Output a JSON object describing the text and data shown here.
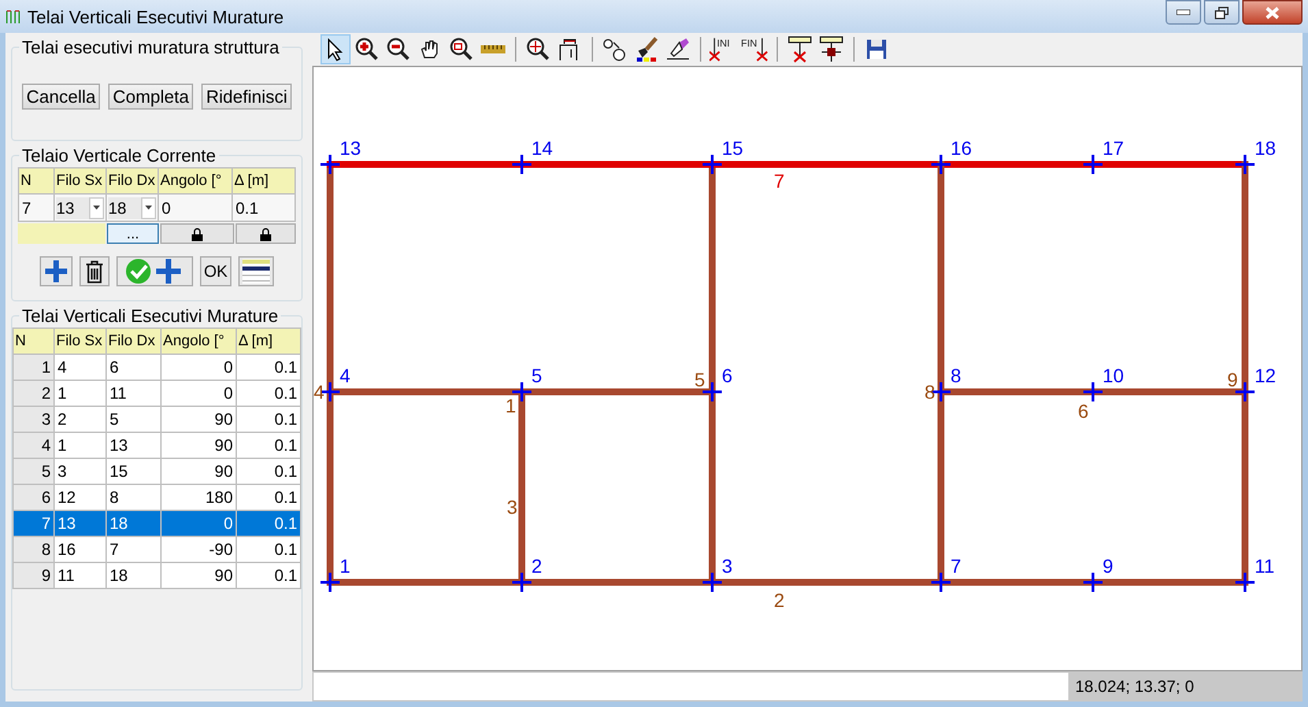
{
  "window": {
    "title": "Telai Verticali Esecutivi Murature"
  },
  "panel_actions": {
    "title": "Telai esecutivi muratura struttura",
    "buttons": [
      "Cancella",
      "Completa",
      "Ridefinisci"
    ]
  },
  "current_frame": {
    "title": "Telaio Verticale Corrente",
    "columns": [
      "N",
      "Filo Sx",
      "Filo Dx",
      "Angolo [°",
      "Δ [m]"
    ],
    "n": "7",
    "filo_sx": "13",
    "filo_dx": "18",
    "angolo": "0",
    "delta": "0.1",
    "browse_button": "...",
    "actions": [
      {
        "kind": "add"
      },
      {
        "kind": "delete"
      },
      {
        "kind": "confirm-add"
      },
      {
        "kind": "ok",
        "label": "OK"
      },
      {
        "kind": "list"
      }
    ]
  },
  "frames_table": {
    "title": "Telai Verticali Esecutivi Murature",
    "columns": [
      "N",
      "Filo Sx",
      "Filo Dx",
      "Angolo [°",
      "Δ [m]"
    ],
    "rows": [
      {
        "n": "1",
        "filo_sx": "4",
        "filo_dx": "6",
        "angolo": "0",
        "delta": "0.1",
        "selected": false
      },
      {
        "n": "2",
        "filo_sx": "1",
        "filo_dx": "11",
        "angolo": "0",
        "delta": "0.1",
        "selected": false
      },
      {
        "n": "3",
        "filo_sx": "2",
        "filo_dx": "5",
        "angolo": "90",
        "delta": "0.1",
        "selected": false
      },
      {
        "n": "4",
        "filo_sx": "1",
        "filo_dx": "13",
        "angolo": "90",
        "delta": "0.1",
        "selected": false
      },
      {
        "n": "5",
        "filo_sx": "3",
        "filo_dx": "15",
        "angolo": "90",
        "delta": "0.1",
        "selected": false
      },
      {
        "n": "6",
        "filo_sx": "12",
        "filo_dx": "8",
        "angolo": "180",
        "delta": "0.1",
        "selected": false
      },
      {
        "n": "7",
        "filo_sx": "13",
        "filo_dx": "18",
        "angolo": "0",
        "delta": "0.1",
        "selected": true
      },
      {
        "n": "8",
        "filo_sx": "16",
        "filo_dx": "7",
        "angolo": "-90",
        "delta": "0.1",
        "selected": false
      },
      {
        "n": "9",
        "filo_sx": "11",
        "filo_dx": "18",
        "angolo": "90",
        "delta": "0.1",
        "selected": false
      }
    ]
  },
  "toolbar": {
    "groups": [
      [
        {
          "kind": "pointer",
          "selected": true
        },
        {
          "kind": "zoom-in",
          "selected": false
        },
        {
          "kind": "zoom-out",
          "selected": false
        },
        {
          "kind": "pan",
          "selected": false
        },
        {
          "kind": "zoom-window",
          "selected": false
        },
        {
          "kind": "ruler",
          "selected": false
        }
      ],
      [
        {
          "kind": "zoom-extents",
          "selected": false
        },
        {
          "kind": "fit",
          "selected": false
        }
      ],
      [
        {
          "kind": "nodes",
          "selected": false
        },
        {
          "kind": "paint",
          "selected": false
        },
        {
          "kind": "eraser",
          "selected": false
        }
      ],
      [
        {
          "kind": "start",
          "text": "INI",
          "selected": false
        },
        {
          "kind": "end",
          "text": "FIN",
          "selected": false
        }
      ],
      [
        {
          "kind": "node-remove",
          "selected": false
        },
        {
          "kind": "node-cross",
          "selected": false
        }
      ],
      [
        {
          "kind": "save",
          "selected": false
        }
      ]
    ]
  },
  "drawing": {
    "nodes": [
      "13",
      "14",
      "15",
      "16",
      "17",
      "18",
      "4",
      "5",
      "6",
      "8",
      "10",
      "12",
      "1",
      "2",
      "3",
      "7",
      "9",
      "11"
    ],
    "frames": [
      {
        "label": "1",
        "selected": false
      },
      {
        "label": "2",
        "selected": false
      },
      {
        "label": "3",
        "selected": false
      },
      {
        "label": "4",
        "selected": false
      },
      {
        "label": "5",
        "selected": false
      },
      {
        "label": "6",
        "selected": false
      },
      {
        "label": "7",
        "selected": true
      },
      {
        "label": "8",
        "selected": false
      },
      {
        "label": "9",
        "selected": false
      }
    ]
  },
  "status_bar": {
    "coordinates": "18.024; 13.37; 0"
  }
}
